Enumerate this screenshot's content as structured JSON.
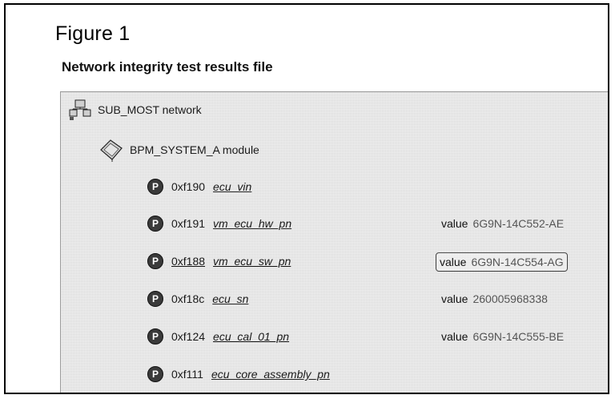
{
  "figure": {
    "label": "Figure 1"
  },
  "document": {
    "title": "Network integrity test results file"
  },
  "tree": {
    "network": {
      "name": "SUB_MOST network",
      "icon": "network-icon"
    },
    "module": {
      "name": "BPM_SYSTEM_A module",
      "icon": "module-icon"
    },
    "params": [
      {
        "icon_text": "P",
        "code": "0xf190",
        "name": "ecu_vin",
        "value_key": "",
        "value": ""
      },
      {
        "icon_text": "P",
        "code": "0xf191",
        "name": "vm_ecu_hw_pn",
        "value_key": "value",
        "value": "6G9N-14C552-AE"
      },
      {
        "icon_text": "P",
        "code": "0xf188",
        "name": "vm_ecu_sw_pn",
        "value_key": "value",
        "value": "6G9N-14C554-AG"
      },
      {
        "icon_text": "P",
        "code": "0xf18c",
        "name": "ecu_sn",
        "value_key": "value",
        "value": "260005968338"
      },
      {
        "icon_text": "P",
        "code": "0xf124",
        "name": "ecu_cal_01_pn",
        "value_key": "value",
        "value": "6G9N-14C555-BE"
      },
      {
        "icon_text": "P",
        "code": "0xf111",
        "name": "ecu_core_assembly_pn",
        "value_key": "",
        "value": ""
      }
    ]
  }
}
